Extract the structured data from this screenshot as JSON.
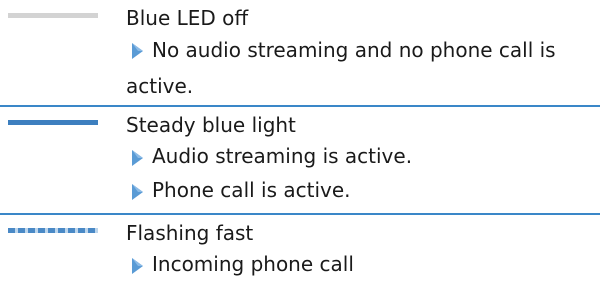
{
  "colors": {
    "accent": "#3a87c8",
    "led_off": "#d3d3d3",
    "led_steady": "#3d7fbf",
    "led_flash": "#4a89c6",
    "marker": "#5a9bd5"
  },
  "rows": [
    {
      "indicator": "led-off-bar",
      "title": "Blue LED off",
      "items": [
        "No audio streaming and no phone call is active."
      ]
    },
    {
      "indicator": "led-steady-bar",
      "title": "Steady blue light",
      "items": [
        "Audio streaming is active.",
        "Phone call is active."
      ]
    },
    {
      "indicator": "led-flashing-bar",
      "title": "Flashing fast",
      "items": [
        "Incoming phone call"
      ]
    }
  ]
}
